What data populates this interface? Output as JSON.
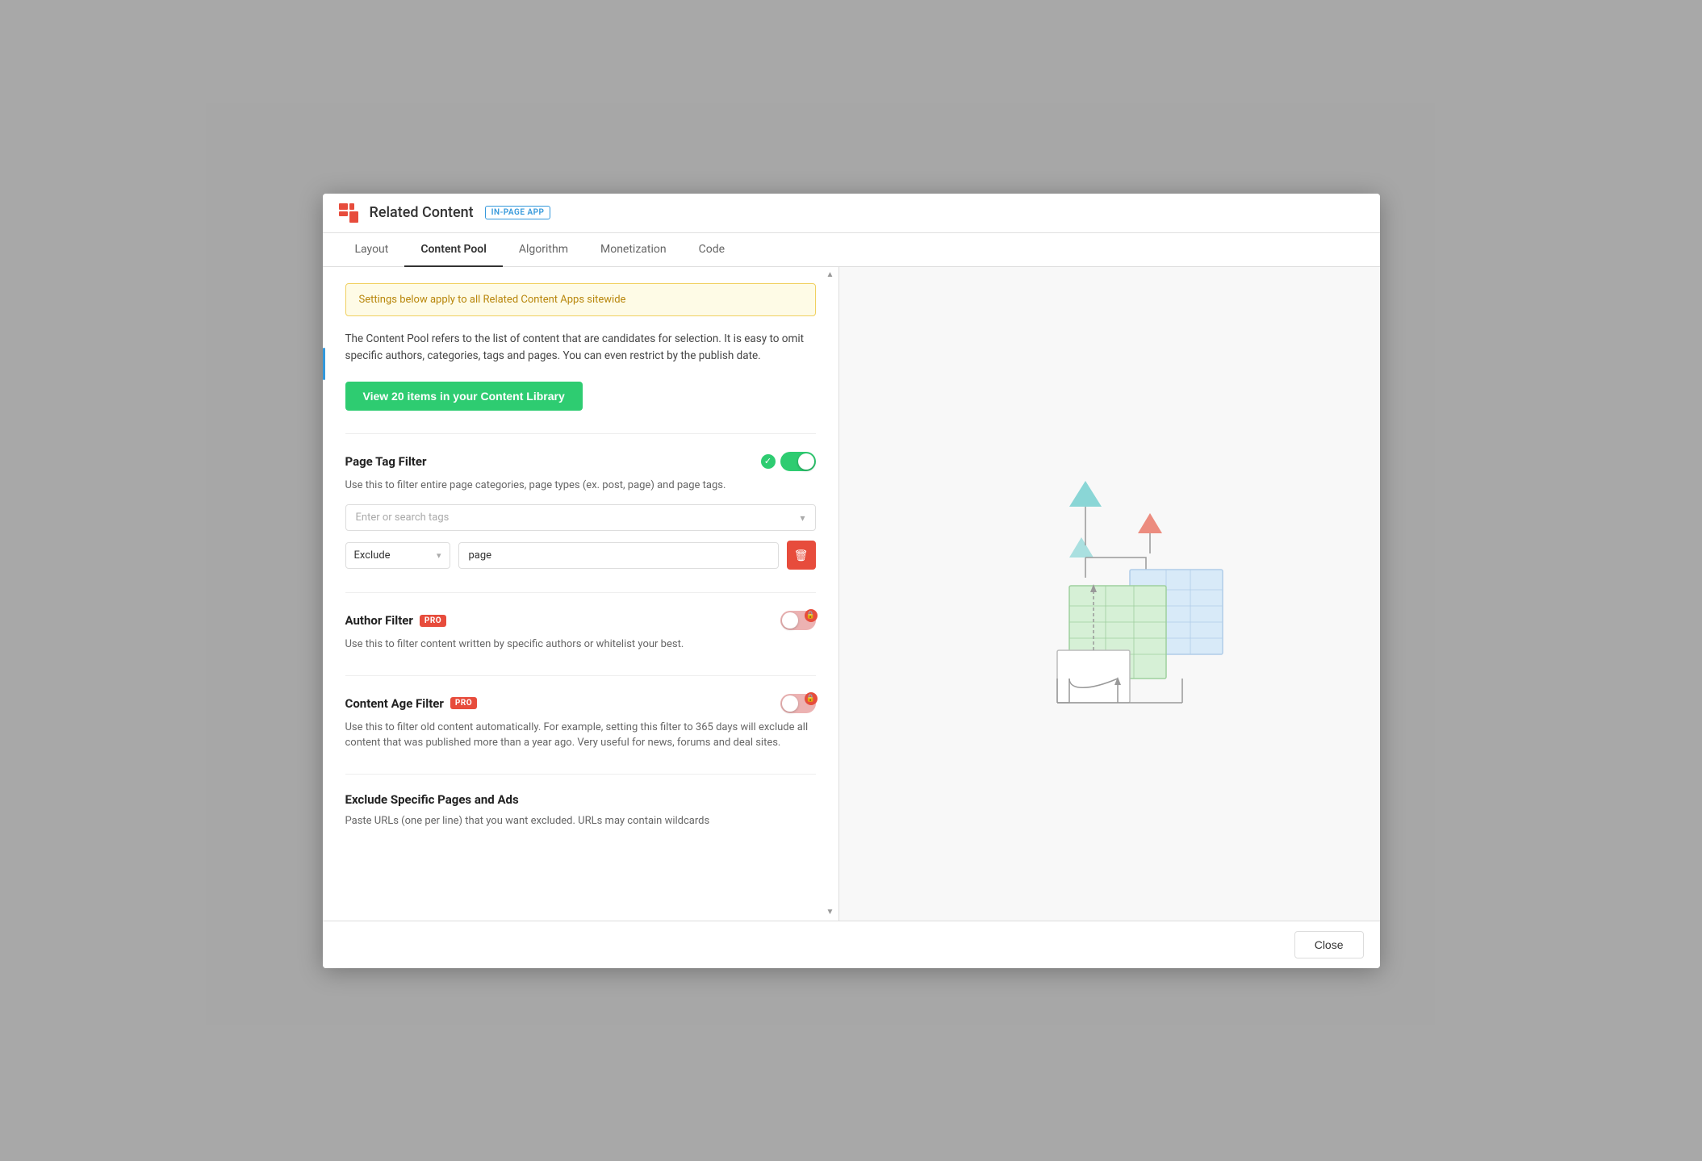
{
  "app": {
    "title": "Related Content",
    "badge": "IN-PAGE APP"
  },
  "tabs": [
    {
      "label": "Layout",
      "active": false
    },
    {
      "label": "Content Pool",
      "active": true
    },
    {
      "label": "Algorithm",
      "active": false
    },
    {
      "label": "Monetization",
      "active": false
    },
    {
      "label": "Code",
      "active": false
    }
  ],
  "warning_banner": "Settings below apply to all Related Content Apps sitewide",
  "description": "The Content Pool refers to the list of content that are candidates for selection. It is easy to omit specific authors, categories, tags and pages. You can even restrict by the publish date.",
  "view_library_btn": "View 20 items in your Content Library",
  "page_tag_filter": {
    "title": "Page Tag Filter",
    "toggle_on": true,
    "description": "Use this to filter entire page categories, page types (ex. post, page) and page tags.",
    "tag_placeholder": "Enter or search tags",
    "filters": [
      {
        "type": "Exclude",
        "value": "page"
      }
    ]
  },
  "author_filter": {
    "title": "Author Filter",
    "pro": true,
    "toggle_on": false,
    "locked": true,
    "description": "Use this to filter content written by specific authors or whitelist your best."
  },
  "content_age_filter": {
    "title": "Content Age Filter",
    "pro": true,
    "toggle_on": false,
    "locked": true,
    "description": "Use this to filter old content automatically. For example, setting this filter to 365 days will exclude all content that was published more than a year ago. Very useful for news, forums and deal sites."
  },
  "exclude_section": {
    "title": "Exclude Specific Pages and Ads",
    "description": "Paste URLs (one per line) that you want excluded. URLs may contain wildcards"
  },
  "footer": {
    "close_label": "Close"
  },
  "icons": {
    "chevron_down": "▾",
    "trash": "🗑",
    "lock": "🔒",
    "check": "✓"
  }
}
